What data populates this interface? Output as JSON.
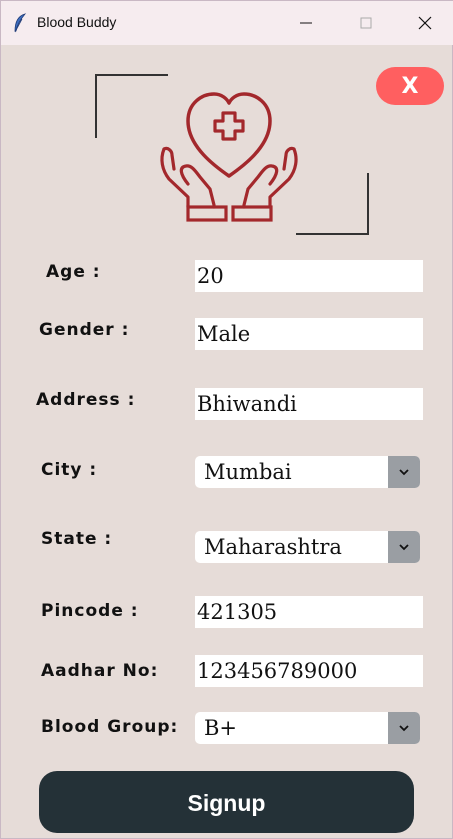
{
  "window": {
    "title": "Blood Buddy",
    "title_icon": "feather-icon"
  },
  "close_label": "X",
  "form": {
    "age_label": "Age :",
    "age_value": "20",
    "gender_label": "Gender :",
    "gender_value": "Male",
    "address_label": "Address  :",
    "address_value": "Bhiwandi",
    "city_label": "City :",
    "city_value": "Mumbai",
    "state_label": "State :",
    "state_value": "Maharashtra",
    "pincode_label": "Pincode :",
    "pincode_value": "421305",
    "aadhar_label": "Aadhar No:",
    "aadhar_value": "123456789000",
    "blood_label": "Blood Group:",
    "blood_value": "B+"
  },
  "signup_label": "Signup",
  "colors": {
    "accent_close": "#ff5f60",
    "logo": "#a3282c",
    "signup_bg": "#243137",
    "background": "#e6dcd8"
  }
}
